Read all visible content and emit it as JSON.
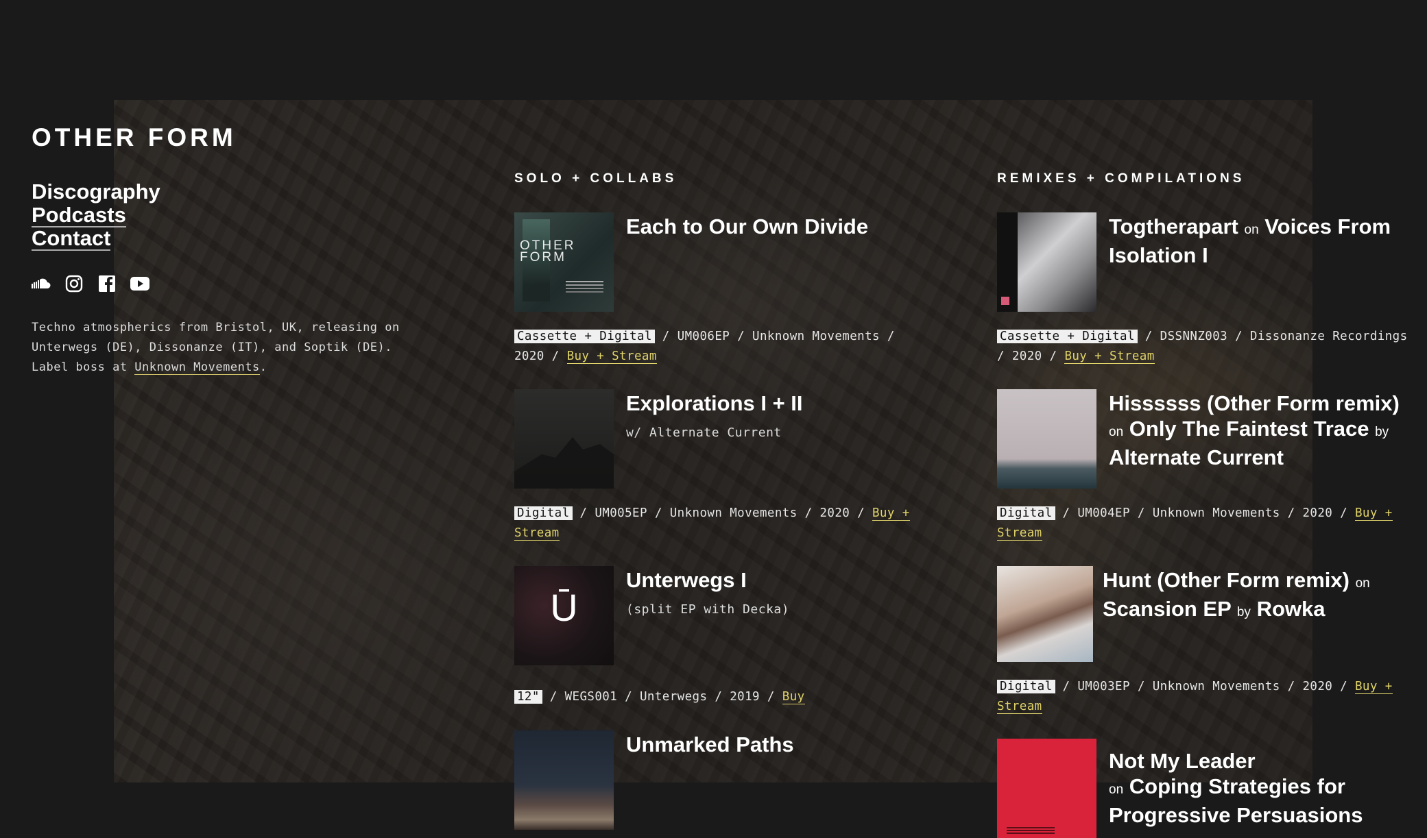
{
  "site": {
    "logo": "OTHER FORM",
    "nav": [
      {
        "label": "Discography"
      },
      {
        "label": "Podcasts"
      },
      {
        "label": "Contact"
      }
    ],
    "bio_text": "Techno atmospherics from Bristol, UK, releasing on Unterwegs (DE), Dissonanze (IT), and Soptik (DE). Label boss at ",
    "bio_link": "Unknown Movements",
    "bio_end": "."
  },
  "socials": [
    "soundcloud-icon",
    "instagram-icon",
    "facebook-icon",
    "youtube-icon"
  ],
  "colors": {
    "background": "#1a1a1b",
    "link_accent": "#e0d36a",
    "format_badge": "#f0f0f0"
  },
  "solo": {
    "heading": "SOLO + COLLABS",
    "releases": [
      {
        "title": "Each to Our Own Divide",
        "subtitle": "",
        "format": "Cassette + Digital",
        "meta": " / UM006EP / Unknown Movements / 2020 / ",
        "buy": "Buy + Stream"
      },
      {
        "title": "Explorations I + II",
        "subtitle": "w/ Alternate Current",
        "format": "Digital",
        "meta": " / UM005EP / Unknown Movements / 2020 / ",
        "buy": "Buy + Stream"
      },
      {
        "title": "Unterwegs I",
        "subtitle": "(split EP with Decka)",
        "format": "12\"",
        "meta": " / WEGS001 / Unterwegs / 2019 / ",
        "buy": "Buy"
      },
      {
        "title": "Unmarked Paths",
        "subtitle": "",
        "format": "",
        "meta": "",
        "buy": ""
      }
    ]
  },
  "remix": {
    "heading": "REMIXES + COMPILATIONS",
    "releases": [
      {
        "track": "Togtherapart",
        "on": "on",
        "release": "Voices From Isolation I",
        "by": "",
        "artist": "",
        "format": "Cassette + Digital",
        "meta": " / DSSNNZ003 / Dissonanze Recordings / 2020 / ",
        "buy": "Buy + Stream"
      },
      {
        "track": "Hissssss (Other Form remix)",
        "on": "on",
        "release": "Only The Faintest Trace",
        "by": "by",
        "artist": "Alternate Current",
        "format": "Digital",
        "meta": " / UM004EP / Unknown Movements / 2020 / ",
        "buy": "Buy + Stream"
      },
      {
        "track": "Hunt (Other Form remix)",
        "on": "on",
        "release": "Scansion EP",
        "by": "by",
        "artist": "Rowka",
        "format": "Digital",
        "meta": " / UM003EP / Unknown Movements / 2020 / ",
        "buy": "Buy + Stream"
      },
      {
        "track": "Not My Leader",
        "on": "on",
        "release": "Coping Strategies for Progressive Persuasions",
        "by": "",
        "artist": "",
        "format": "",
        "meta": "",
        "buy": ""
      }
    ]
  },
  "cover_text": {
    "c1_band": "OTHER\nFORM",
    "c3_mark": "Ū"
  }
}
